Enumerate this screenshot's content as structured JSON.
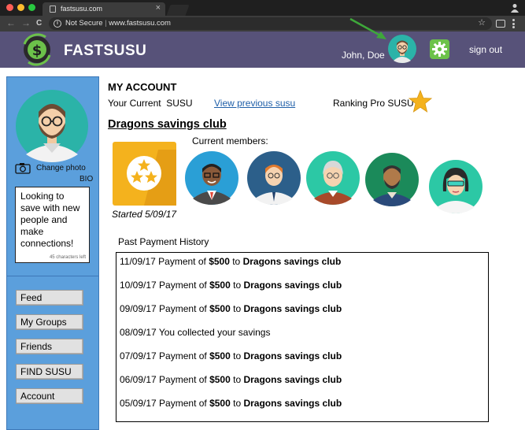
{
  "browser": {
    "tab_title": "fastsusu.com",
    "tab_close": "×",
    "security_label": "Not Secure",
    "separator": "|",
    "url": "www.fastsusu.com",
    "nav_back": "←",
    "nav_forward": "→",
    "nav_reload": "C",
    "star": "☆",
    "info": "i"
  },
  "header": {
    "brand": "FASTSUSU",
    "username": "John, Doe",
    "signout": "sign out"
  },
  "sidebar": {
    "change_photo": "Change photo",
    "bio_label": "BIO",
    "bio_text": "Looking to save with new people and make connections!",
    "bio_count": "45 characters left",
    "nav_items": [
      "Feed",
      "My Groups",
      "Friends",
      "FIND SUSU",
      "Account"
    ]
  },
  "main": {
    "title": "MY ACCOUNT",
    "current_susu": "Your Current  SUSU",
    "previous_link": "View previous susu",
    "ranking": "Ranking Pro SUSU",
    "club_name": "Dragons savings club",
    "started": "Started 5/09/17",
    "members_label": "Current members:",
    "history_label": "Past Payment History",
    "history": [
      {
        "prefix": "11/09/17  Payment of  ",
        "amount": "$500",
        "mid": " to ",
        "target": "Dragons savings club"
      },
      {
        "prefix": "10/09/17 Payment of  ",
        "amount": "$500",
        "mid": " to ",
        "target": "Dragons savings club"
      },
      {
        "prefix": "09/09/17 Payment of  ",
        "amount": "$500",
        "mid": " to ",
        "target": "Dragons savings club"
      },
      {
        "prefix": "08/09/17 You collected your savings",
        "amount": "",
        "mid": "",
        "target": ""
      },
      {
        "prefix": "07/09/17 Payment of  ",
        "amount": "$500",
        "mid": " to ",
        "target": "Dragons savings club"
      },
      {
        "prefix": "06/09/17 Payment of  ",
        "amount": "$500",
        "mid": " to ",
        "target": "Dragons savings club"
      },
      {
        "prefix": "05/09/17 Payment of  ",
        "amount": "$500",
        "mid": " to ",
        "target": "Dragons savings club"
      }
    ]
  },
  "colors": {
    "header_bg": "#575279",
    "sidebar_bg": "#5b9fdc",
    "badge_gold": "#f4b21d",
    "settings_green": "#6cc24a",
    "link_blue": "#1f5fa8",
    "arrow_green": "#3ea83a"
  },
  "icons": [
    "profile-icon",
    "info-icon",
    "star-icon",
    "extension-icon",
    "menu-icon",
    "logo-icon",
    "gear-icon",
    "camera-icon",
    "ranking-star-icon",
    "stars-badge-icon",
    "arrow-icon"
  ]
}
